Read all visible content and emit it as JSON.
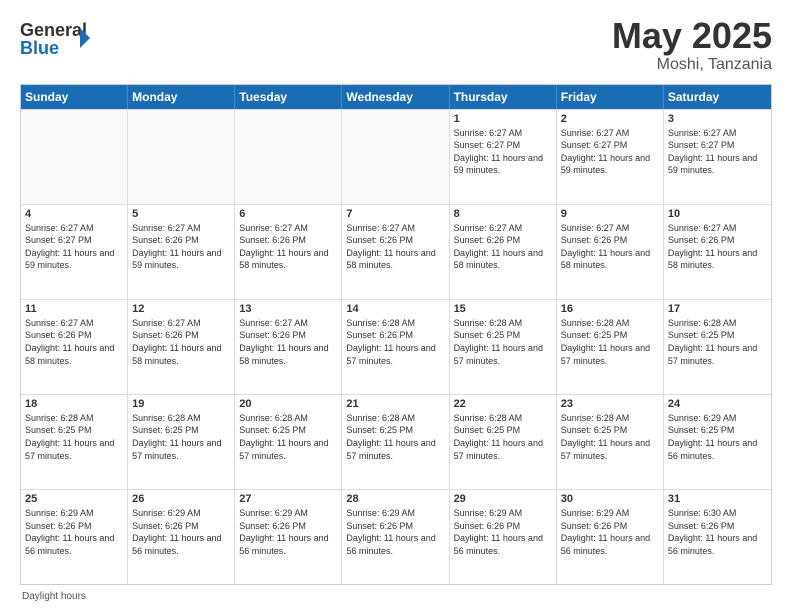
{
  "header": {
    "logo_general": "General",
    "logo_blue": "Blue",
    "title": "May 2025",
    "location": "Moshi, Tanzania"
  },
  "days_of_week": [
    "Sunday",
    "Monday",
    "Tuesday",
    "Wednesday",
    "Thursday",
    "Friday",
    "Saturday"
  ],
  "weeks": [
    [
      {
        "day": "",
        "info": "",
        "empty": true
      },
      {
        "day": "",
        "info": "",
        "empty": true
      },
      {
        "day": "",
        "info": "",
        "empty": true
      },
      {
        "day": "",
        "info": "",
        "empty": true
      },
      {
        "day": "1",
        "info": "Sunrise: 6:27 AM\nSunset: 6:27 PM\nDaylight: 11 hours and 59 minutes."
      },
      {
        "day": "2",
        "info": "Sunrise: 6:27 AM\nSunset: 6:27 PM\nDaylight: 11 hours and 59 minutes."
      },
      {
        "day": "3",
        "info": "Sunrise: 6:27 AM\nSunset: 6:27 PM\nDaylight: 11 hours and 59 minutes."
      }
    ],
    [
      {
        "day": "4",
        "info": "Sunrise: 6:27 AM\nSunset: 6:27 PM\nDaylight: 11 hours and 59 minutes."
      },
      {
        "day": "5",
        "info": "Sunrise: 6:27 AM\nSunset: 6:26 PM\nDaylight: 11 hours and 59 minutes."
      },
      {
        "day": "6",
        "info": "Sunrise: 6:27 AM\nSunset: 6:26 PM\nDaylight: 11 hours and 58 minutes."
      },
      {
        "day": "7",
        "info": "Sunrise: 6:27 AM\nSunset: 6:26 PM\nDaylight: 11 hours and 58 minutes."
      },
      {
        "day": "8",
        "info": "Sunrise: 6:27 AM\nSunset: 6:26 PM\nDaylight: 11 hours and 58 minutes."
      },
      {
        "day": "9",
        "info": "Sunrise: 6:27 AM\nSunset: 6:26 PM\nDaylight: 11 hours and 58 minutes."
      },
      {
        "day": "10",
        "info": "Sunrise: 6:27 AM\nSunset: 6:26 PM\nDaylight: 11 hours and 58 minutes."
      }
    ],
    [
      {
        "day": "11",
        "info": "Sunrise: 6:27 AM\nSunset: 6:26 PM\nDaylight: 11 hours and 58 minutes."
      },
      {
        "day": "12",
        "info": "Sunrise: 6:27 AM\nSunset: 6:26 PM\nDaylight: 11 hours and 58 minutes."
      },
      {
        "day": "13",
        "info": "Sunrise: 6:27 AM\nSunset: 6:26 PM\nDaylight: 11 hours and 58 minutes."
      },
      {
        "day": "14",
        "info": "Sunrise: 6:28 AM\nSunset: 6:26 PM\nDaylight: 11 hours and 57 minutes."
      },
      {
        "day": "15",
        "info": "Sunrise: 6:28 AM\nSunset: 6:25 PM\nDaylight: 11 hours and 57 minutes."
      },
      {
        "day": "16",
        "info": "Sunrise: 6:28 AM\nSunset: 6:25 PM\nDaylight: 11 hours and 57 minutes."
      },
      {
        "day": "17",
        "info": "Sunrise: 6:28 AM\nSunset: 6:25 PM\nDaylight: 11 hours and 57 minutes."
      }
    ],
    [
      {
        "day": "18",
        "info": "Sunrise: 6:28 AM\nSunset: 6:25 PM\nDaylight: 11 hours and 57 minutes."
      },
      {
        "day": "19",
        "info": "Sunrise: 6:28 AM\nSunset: 6:25 PM\nDaylight: 11 hours and 57 minutes."
      },
      {
        "day": "20",
        "info": "Sunrise: 6:28 AM\nSunset: 6:25 PM\nDaylight: 11 hours and 57 minutes."
      },
      {
        "day": "21",
        "info": "Sunrise: 6:28 AM\nSunset: 6:25 PM\nDaylight: 11 hours and 57 minutes."
      },
      {
        "day": "22",
        "info": "Sunrise: 6:28 AM\nSunset: 6:25 PM\nDaylight: 11 hours and 57 minutes."
      },
      {
        "day": "23",
        "info": "Sunrise: 6:28 AM\nSunset: 6:25 PM\nDaylight: 11 hours and 57 minutes."
      },
      {
        "day": "24",
        "info": "Sunrise: 6:29 AM\nSunset: 6:25 PM\nDaylight: 11 hours and 56 minutes."
      }
    ],
    [
      {
        "day": "25",
        "info": "Sunrise: 6:29 AM\nSunset: 6:26 PM\nDaylight: 11 hours and 56 minutes."
      },
      {
        "day": "26",
        "info": "Sunrise: 6:29 AM\nSunset: 6:26 PM\nDaylight: 11 hours and 56 minutes."
      },
      {
        "day": "27",
        "info": "Sunrise: 6:29 AM\nSunset: 6:26 PM\nDaylight: 11 hours and 56 minutes."
      },
      {
        "day": "28",
        "info": "Sunrise: 6:29 AM\nSunset: 6:26 PM\nDaylight: 11 hours and 56 minutes."
      },
      {
        "day": "29",
        "info": "Sunrise: 6:29 AM\nSunset: 6:26 PM\nDaylight: 11 hours and 56 minutes."
      },
      {
        "day": "30",
        "info": "Sunrise: 6:29 AM\nSunset: 6:26 PM\nDaylight: 11 hours and 56 minutes."
      },
      {
        "day": "31",
        "info": "Sunrise: 6:30 AM\nSunset: 6:26 PM\nDaylight: 11 hours and 56 minutes."
      }
    ]
  ],
  "footer": "Daylight hours"
}
